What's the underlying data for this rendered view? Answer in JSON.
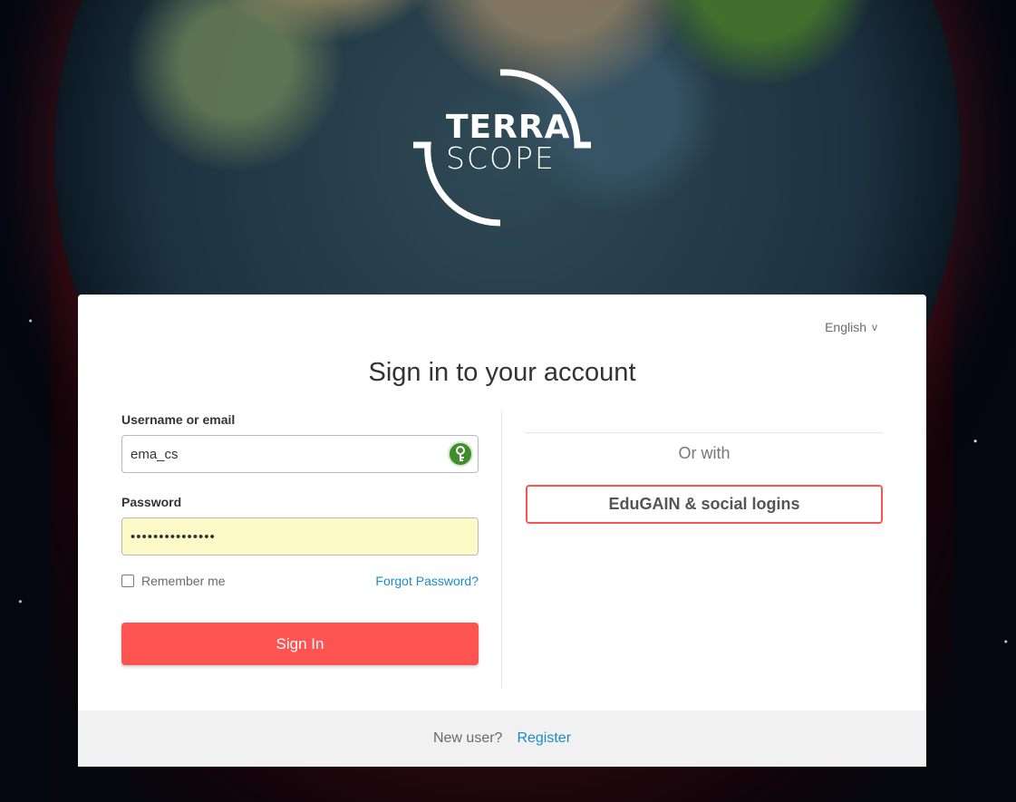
{
  "brand": {
    "logo_line1": "TERRA",
    "logo_line2": "SCOPE"
  },
  "language": {
    "selected": "English",
    "chevron": "v"
  },
  "title": "Sign in to your account",
  "form": {
    "username_label": "Username or email",
    "username_value": "ema_cs",
    "password_label": "Password",
    "password_value": "•••••••••••••••",
    "remember_label": "Remember me",
    "remember_checked": false,
    "forgot_label": "Forgot Password?",
    "signin_label": "Sign In"
  },
  "alt_login": {
    "or_with": "Or with",
    "social_label": "EduGAIN & social logins"
  },
  "footer": {
    "new_user": "New user?",
    "register_label": "Register"
  },
  "colors": {
    "accent": "#fd5452",
    "link": "#1a8cc8",
    "autofill": "#fefac8"
  },
  "icons": {
    "password_manager": "key-icon",
    "language": "chevron-down-icon"
  }
}
